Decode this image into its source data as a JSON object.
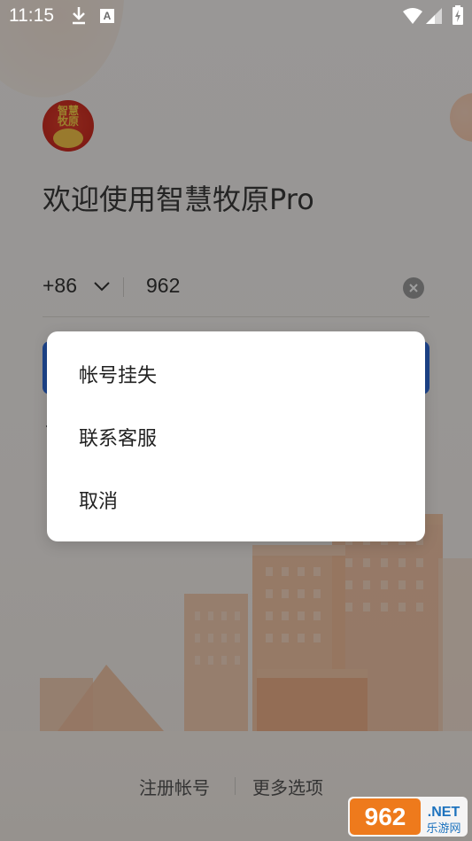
{
  "status_bar": {
    "time": "11:15",
    "icons": [
      "download-icon",
      "a-badge-icon",
      "wifi-icon",
      "signal-icon",
      "battery-icon"
    ],
    "a_badge": "A"
  },
  "logo": {
    "line1": "智慧",
    "line2": "牧原"
  },
  "welcome": {
    "title": "欢迎使用智慧牧原Pro"
  },
  "login_form": {
    "country_code": "+86",
    "phone_value": "962"
  },
  "dialog": {
    "items": [
      {
        "label": "帐号挂失"
      },
      {
        "label": "联系客服"
      },
      {
        "label": "取消"
      }
    ]
  },
  "bottom": {
    "register_label": "注册帐号",
    "more_label": "更多选项"
  },
  "watermark": {
    "brand_number": "962",
    "brand_net": ".NET",
    "brand_subtitle": "乐游网"
  },
  "colors": {
    "accent_blue": "#2f6fe0",
    "logo_red": "#d6322a",
    "logo_gold": "#f9d24a",
    "scrim": "rgba(0,0,0,0.38)"
  }
}
